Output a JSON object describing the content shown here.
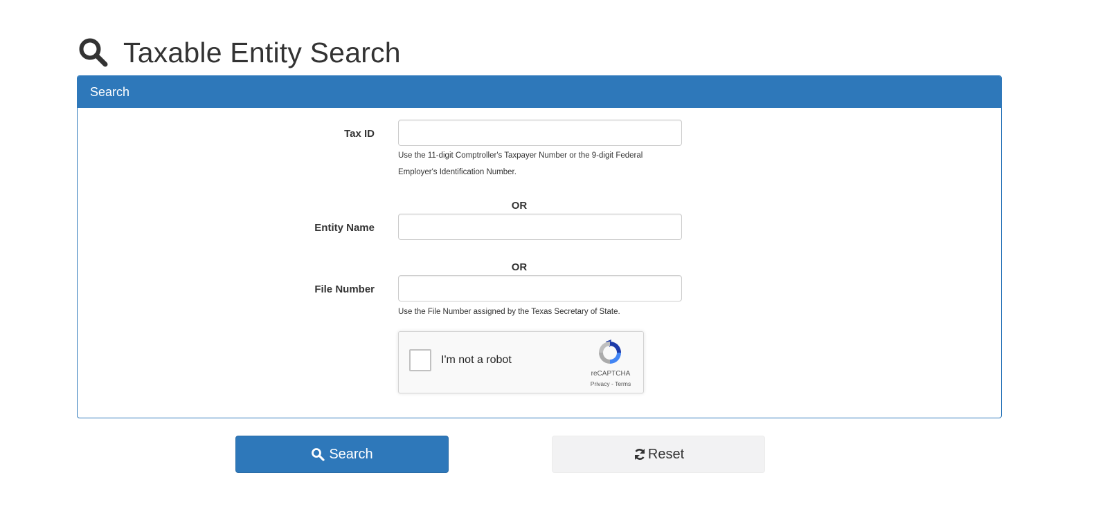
{
  "page": {
    "title": "Taxable Entity Search",
    "title_icon": "search-icon"
  },
  "panel": {
    "heading": "Search"
  },
  "form": {
    "tax_id": {
      "label": "Tax ID",
      "value": "",
      "help_line1": "Use the 11-digit Comptroller's Taxpayer Number or the 9-digit Federal",
      "help_line2": "Employer's Identification Number."
    },
    "or_1": "OR",
    "entity_name": {
      "label": "Entity Name",
      "value": ""
    },
    "or_2": "OR",
    "file_number": {
      "label": "File Number",
      "value": "",
      "help": "Use the File Number assigned by the Texas Secretary of State."
    }
  },
  "recaptcha": {
    "checkbox_label": "I'm not a robot",
    "brand": "reCAPTCHA",
    "links": "Privacy - Terms",
    "icon": "recaptcha-icon"
  },
  "actions": {
    "search_label": "Search",
    "search_icon": "search-icon",
    "reset_label": "Reset",
    "reset_icon": "refresh-icon"
  },
  "colors": {
    "primary": "#2e78ba",
    "default_button": "#f2f2f3",
    "text": "#333333"
  }
}
